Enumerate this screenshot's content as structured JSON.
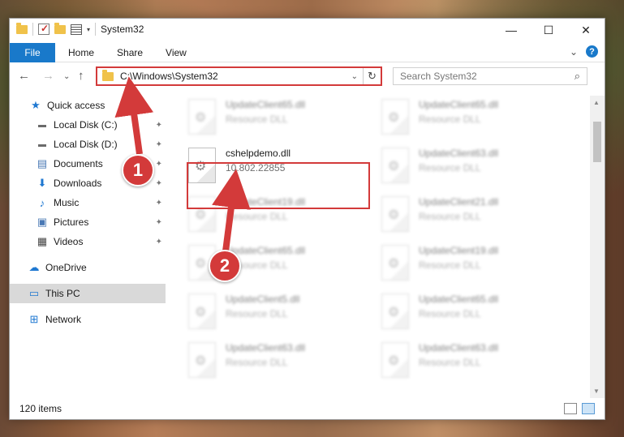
{
  "window": {
    "title": "System32"
  },
  "titlebar": {
    "minimize": "—",
    "maximize": "☐",
    "close": "✕"
  },
  "ribbon": {
    "file_tab": "File",
    "tabs": [
      "Home",
      "Share",
      "View"
    ],
    "expand": "⌄",
    "help": "?"
  },
  "nav": {
    "back": "←",
    "forward": "→",
    "recent": "⌄",
    "up": "↑",
    "address": "C:\\Windows\\System32",
    "address_caret": "⌄",
    "refresh": "↻",
    "search_placeholder": "Search System32",
    "search_icon": "🔍"
  },
  "sidebar": {
    "items": [
      {
        "label": "Quick access",
        "icon": "star-icon",
        "glyph": "★",
        "color": "#1f78d1",
        "pinned": false
      },
      {
        "label": "Local Disk (C:)",
        "icon": "drive-icon",
        "glyph": "▬",
        "color": "#6b6b6b",
        "pinned": true
      },
      {
        "label": "Local Disk (D:)",
        "icon": "drive-icon",
        "glyph": "▬",
        "color": "#6b6b6b",
        "pinned": true
      },
      {
        "label": "Documents",
        "icon": "document-icon",
        "glyph": "📄",
        "color": "#4a79b5",
        "pinned": true
      },
      {
        "label": "Downloads",
        "icon": "download-icon",
        "glyph": "⬇",
        "color": "#1f78d1",
        "pinned": true
      },
      {
        "label": "Music",
        "icon": "music-icon",
        "glyph": "♪",
        "color": "#1f78d1",
        "pinned": true
      },
      {
        "label": "Pictures",
        "icon": "pictures-icon",
        "glyph": "▣",
        "color": "#4a79b5",
        "pinned": true
      },
      {
        "label": "Videos",
        "icon": "videos-icon",
        "glyph": "▦",
        "color": "#444",
        "pinned": true
      },
      {
        "label": "OneDrive",
        "icon": "cloud-icon",
        "glyph": "☁",
        "color": "#1f78d1",
        "pinned": false
      },
      {
        "label": "This PC",
        "icon": "computer-icon",
        "glyph": "▭",
        "color": "#1f78d1",
        "pinned": false
      },
      {
        "label": "Network",
        "icon": "network-icon",
        "glyph": "⊞",
        "color": "#1f78d1",
        "pinned": false
      }
    ],
    "pin_glyph": "📌"
  },
  "files": [
    {
      "name": "UpdateClient65.dll",
      "desc": "Resource DLL",
      "blurred": true
    },
    {
      "name": "UpdateClient65.dll",
      "desc": "Resource DLL",
      "blurred": true
    },
    {
      "name": "cshelpdemo.dll",
      "desc": "10.802.22855",
      "blurred": false
    },
    {
      "name": "UpdateClient63.dll",
      "desc": "Resource DLL",
      "blurred": true
    },
    {
      "name": "UpdateClient19.dll",
      "desc": "Resource DLL",
      "blurred": true
    },
    {
      "name": "UpdateClient21.dll",
      "desc": "Resource DLL",
      "blurred": true
    },
    {
      "name": "UpdateClient65.dll",
      "desc": "Resource DLL",
      "blurred": true
    },
    {
      "name": "UpdateClient19.dll",
      "desc": "Resource DLL",
      "blurred": true
    },
    {
      "name": "UpdateClient5.dll",
      "desc": "Resource DLL",
      "blurred": true
    },
    {
      "name": "UpdateClient65.dll",
      "desc": "Resource DLL",
      "blurred": true
    },
    {
      "name": "UpdateClient63.dll",
      "desc": "Resource DLL",
      "blurred": true
    },
    {
      "name": "UpdateClient63.dll",
      "desc": "Resource DLL",
      "blurred": true
    }
  ],
  "status": {
    "items": "120 items"
  },
  "annotations": {
    "badge1": "1",
    "badge2": "2",
    "color": "#d33a3a"
  }
}
